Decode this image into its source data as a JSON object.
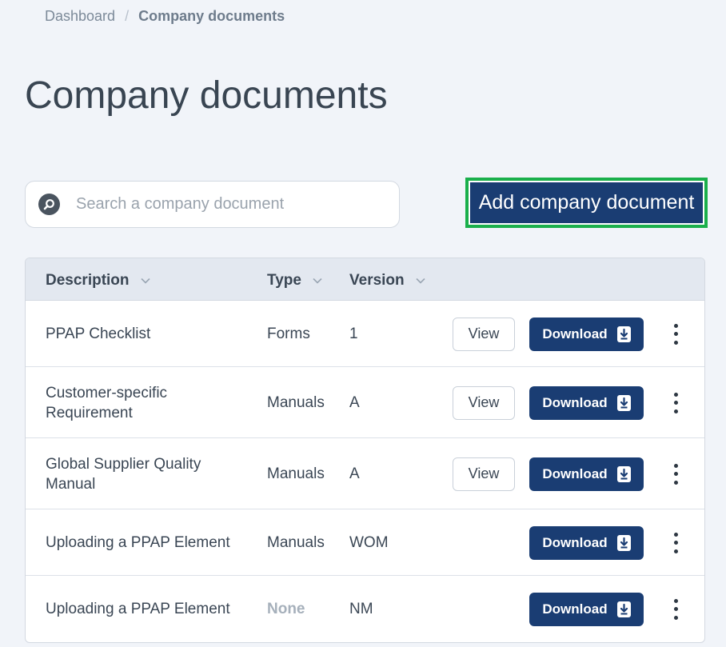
{
  "breadcrumb": {
    "home": "Dashboard",
    "current": "Company documents",
    "separator": "/"
  },
  "page": {
    "title": "Company documents"
  },
  "search": {
    "placeholder": "Search a company document",
    "value": ""
  },
  "actions": {
    "add_label": "Add company document"
  },
  "table": {
    "columns": [
      "Description",
      "Type",
      "Version"
    ],
    "view_label": "View",
    "download_label": "Download",
    "rows": [
      {
        "description": [
          "PPAP Checklist"
        ],
        "type": "Forms",
        "version": "1",
        "has_view": true
      },
      {
        "description": [
          "Customer-specific",
          "Requirement"
        ],
        "type": "Manuals",
        "version": "A",
        "has_view": true
      },
      {
        "description": [
          "Global Supplier Quality",
          "Manual"
        ],
        "type": "Manuals",
        "version": "A",
        "has_view": true
      },
      {
        "description": [
          "Uploading a PPAP Element"
        ],
        "type": "Manuals",
        "version": "WOM",
        "has_view": false
      },
      {
        "description": [
          "Uploading a PPAP Element"
        ],
        "type": "None",
        "version": "NM",
        "has_view": false,
        "type_muted": true
      }
    ]
  },
  "colors": {
    "primary": "#1a3d73",
    "highlight_border": "#1aaf4b",
    "background": "#f1f4f9"
  }
}
